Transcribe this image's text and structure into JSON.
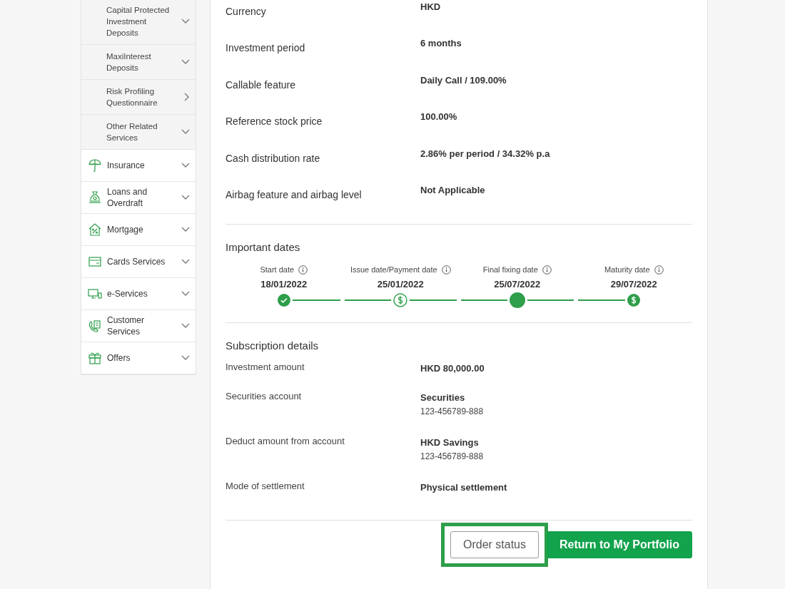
{
  "sidebar": {
    "sub_items": [
      {
        "label": "Capital Protected Investment Deposits",
        "kind": "expand"
      },
      {
        "label": "MaxiInterest Deposits",
        "kind": "expand"
      },
      {
        "label": "Risk Profiling Questionnaire",
        "kind": "link"
      },
      {
        "label": "Other Related Services",
        "kind": "expand"
      }
    ],
    "items": [
      {
        "label": "Insurance"
      },
      {
        "label": "Loans and Overdraft"
      },
      {
        "label": "Mortgage"
      },
      {
        "label": "Cards Services"
      },
      {
        "label": "e-Services"
      },
      {
        "label": "Customer Services"
      },
      {
        "label": "Offers"
      }
    ]
  },
  "details": [
    {
      "label": "Currency",
      "value": "HKD"
    },
    {
      "label": "Investment period",
      "value": "6 months"
    },
    {
      "label": "Callable feature",
      "value": "Daily Call / 109.00%"
    },
    {
      "label": "Reference stock price",
      "value": "100.00%"
    },
    {
      "label": "Cash distribution rate",
      "value": "2.86% per period / 34.32% p.a"
    },
    {
      "label": "Airbag feature and airbag level",
      "value": "Not Applicable"
    }
  ],
  "important_dates": {
    "title": "Important dates",
    "steps": [
      {
        "label": "Start date",
        "date": "18/01/2022",
        "kind": "done"
      },
      {
        "label": "Issue date/Payment date",
        "date": "25/01/2022",
        "kind": "payment-outline"
      },
      {
        "label": "Final fixing date",
        "date": "25/07/2022",
        "kind": "current"
      },
      {
        "label": "Maturity date",
        "date": "29/07/2022",
        "kind": "payment"
      }
    ]
  },
  "subscription": {
    "title": "Subscription details",
    "rows": [
      {
        "label": "Investment amount",
        "value": "HKD 80,000.00"
      },
      {
        "label": "Securities account",
        "value": "Securities",
        "sub": "123-456789-888"
      },
      {
        "label": "Deduct amount from account",
        "value": "HKD Savings",
        "sub": "123-456789-888"
      },
      {
        "label": "Mode of settlement",
        "value": "Physical settlement"
      }
    ]
  },
  "buttons": [
    {
      "label": "Order status",
      "kind": "secondary",
      "highlighted": true
    },
    {
      "label": "Return to My Portfolio",
      "kind": "primary",
      "highlighted": false
    }
  ]
}
